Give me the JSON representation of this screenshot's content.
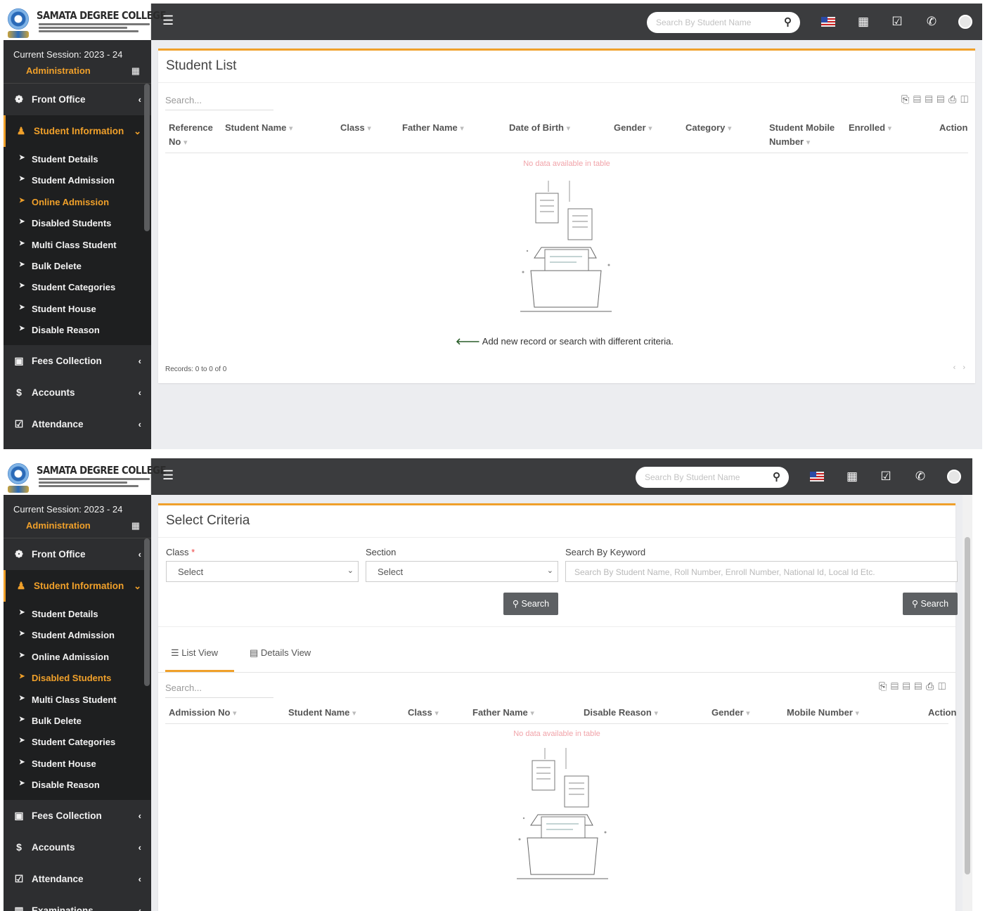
{
  "app": {
    "college_name": "SAMATA DEGREE COLLEGE",
    "search_placeholder": "Search By Student Name",
    "session_text": "Current Session: 2023 - 24",
    "session_role": "Administration"
  },
  "sidebar": {
    "top_items": [
      {
        "label": "Front Office",
        "icon": "globe-icon"
      },
      {
        "label": "Student Information",
        "icon": "users-icon"
      }
    ],
    "sub_items": [
      "Student Details",
      "Student Admission",
      "Online Admission",
      "Disabled Students",
      "Multi Class Student",
      "Bulk Delete",
      "Student Categories",
      "Student House",
      "Disable Reason"
    ],
    "bottom_items": [
      {
        "label": "Fees Collection",
        "icon": "money-icon"
      },
      {
        "label": "Accounts",
        "icon": "dollar-icon"
      },
      {
        "label": "Attendance",
        "icon": "calendar-check-icon"
      },
      {
        "label": "Examinations",
        "icon": "map-icon"
      }
    ]
  },
  "screen1": {
    "title": "Student List",
    "search_placeholder": "Search...",
    "columns": [
      "Reference No",
      "Student Name",
      "Class",
      "Father Name",
      "Date of Birth",
      "Gender",
      "Category",
      "Student Mobile Number",
      "Enrolled",
      "Action"
    ],
    "no_data": "No data available in table",
    "hint": "Add new record or search with different criteria.",
    "records": "Records: 0 to 0 of 0",
    "active_sub": "Online Admission"
  },
  "screen2": {
    "title": "Select Criteria",
    "class_label": "Class",
    "section_label": "Section",
    "keyword_label": "Search By Keyword",
    "select_value": "Select",
    "keyword_placeholder": "Search By Student Name, Roll Number, Enroll Number, National Id, Local Id Etc.",
    "search_button": "Search",
    "tabs": [
      "List View",
      "Details View"
    ],
    "search_placeholder": "Search...",
    "columns": [
      "Admission No",
      "Student Name",
      "Class",
      "Father Name",
      "Disable Reason",
      "Gender",
      "Mobile Number",
      "Action"
    ],
    "no_data": "No data available in table",
    "active_sub": "Disabled Students"
  },
  "colors": {
    "accent": "#f0a02a",
    "topbar": "#3b3c3e",
    "sidebar": "#2d2e30"
  }
}
